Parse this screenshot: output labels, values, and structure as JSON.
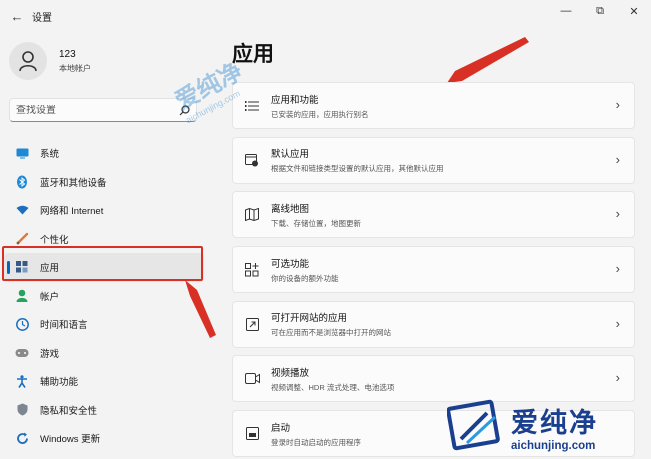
{
  "window": {
    "title": "设置",
    "back_icon": "back-arrow-icon",
    "controls": [
      "minimize-icon",
      "maximize-icon",
      "close-icon"
    ]
  },
  "user": {
    "name": "123",
    "account_type": "本地帐户"
  },
  "search": {
    "placeholder": "查找设置"
  },
  "sidebar": {
    "items": [
      {
        "label": "系统",
        "icon": "monitor-icon",
        "active": false
      },
      {
        "label": "蓝牙和其他设备",
        "icon": "bluetooth-icon",
        "active": false
      },
      {
        "label": "网络和 Internet",
        "icon": "wifi-icon",
        "active": false
      },
      {
        "label": "个性化",
        "icon": "brush-icon",
        "active": false
      },
      {
        "label": "应用",
        "icon": "apps-icon",
        "active": true
      },
      {
        "label": "帐户",
        "icon": "person-icon",
        "active": false
      },
      {
        "label": "时间和语言",
        "icon": "globe-clock-icon",
        "active": false
      },
      {
        "label": "游戏",
        "icon": "gamepad-icon",
        "active": false
      },
      {
        "label": "辅助功能",
        "icon": "accessibility-icon",
        "active": false
      },
      {
        "label": "隐私和安全性",
        "icon": "shield-icon",
        "active": false
      },
      {
        "label": "Windows 更新",
        "icon": "update-icon",
        "active": false
      }
    ]
  },
  "main": {
    "title": "应用",
    "cards": [
      {
        "title": "应用和功能",
        "subtitle": "已安装的应用，应用执行别名",
        "icon": "list-icon"
      },
      {
        "title": "默认应用",
        "subtitle": "根据文件和链接类型设置的默认应用，其他默认应用",
        "icon": "default-apps-icon"
      },
      {
        "title": "离线地图",
        "subtitle": "下载、存储位置，地图更新",
        "icon": "map-icon"
      },
      {
        "title": "可选功能",
        "subtitle": "你的设备的额外功能",
        "icon": "add-feature-icon"
      },
      {
        "title": "可打开网站的应用",
        "subtitle": "可在应用而不是浏览器中打开的网站",
        "icon": "open-web-icon"
      },
      {
        "title": "视频播放",
        "subtitle": "视频调整、HDR 流式处理、电池选项",
        "icon": "video-icon"
      },
      {
        "title": "启动",
        "subtitle": "登录时自动启动的应用程序",
        "icon": "startup-icon"
      }
    ]
  },
  "watermark": {
    "text": "爱纯净",
    "url": "aichunjing.com"
  },
  "colors": {
    "accent": "#0067c0",
    "highlight_red": "#d93025",
    "background": "#f3f3f3",
    "card": "#fbfbfb"
  }
}
